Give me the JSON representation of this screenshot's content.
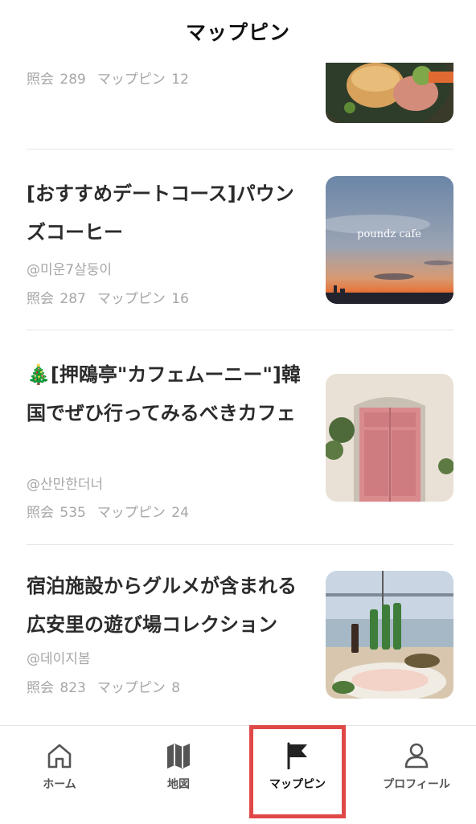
{
  "header": {
    "title": "マップピン"
  },
  "items": [
    {
      "title": "",
      "author": "",
      "views_label": "照会",
      "views": "289",
      "pins_label": "マップピン",
      "pins": "12",
      "thumb_icon": "bread-dish-photo"
    },
    {
      "title": "[おすすめデートコース]パウンズコーヒー",
      "author": "@미운7살둥이",
      "views_label": "照会",
      "views": "287",
      "pins_label": "マップピン",
      "pins": "16",
      "thumb_icon": "sunset-city-photo",
      "thumb_caption": "poundz cafe"
    },
    {
      "title": "🎄[押鴎亭\"カフェムーニー\"]韓国でぜひ行ってみるべきカフェ",
      "author": "@산만한더너",
      "views_label": "照会",
      "views": "535",
      "pins_label": "マップピン",
      "pins": "24",
      "thumb_icon": "pink-door-photo"
    },
    {
      "title": "宿泊施設からグルメが含まれる広安里の遊び場コレクション",
      "author": "@데이지봄",
      "views_label": "照会",
      "views": "823",
      "pins_label": "マップピン",
      "pins": "8",
      "thumb_icon": "beach-sashimi-photo"
    }
  ],
  "tabbar": {
    "tabs": [
      {
        "label": "ホーム",
        "icon": "home-icon"
      },
      {
        "label": "地図",
        "icon": "map-icon"
      },
      {
        "label": "マップピン",
        "icon": "flag-icon",
        "active": true
      },
      {
        "label": "プロフィール",
        "icon": "person-icon"
      }
    ]
  },
  "colors": {
    "highlight": "#e04848",
    "text": "#2b2b2b",
    "muted": "#a6a6a6"
  }
}
